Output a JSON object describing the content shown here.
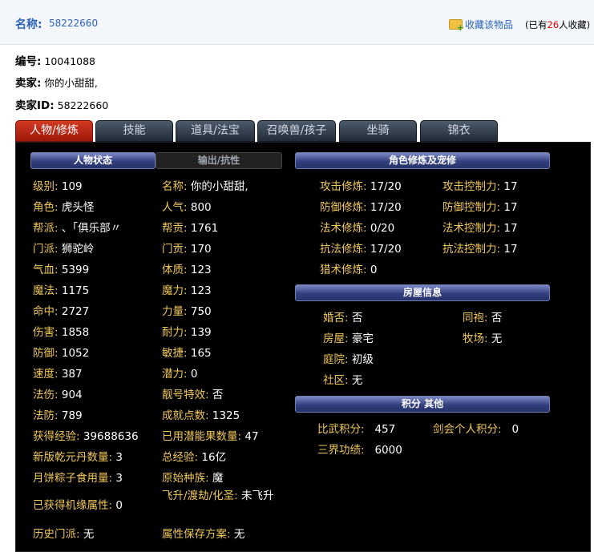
{
  "header": {
    "name_label": "名称:",
    "name_value": "58222660",
    "favorite_link": "收藏该物品",
    "fav_prefix": "(已有",
    "fav_count": "26",
    "fav_suffix": "人收藏)",
    "favorite_icon": "folder-add-icon"
  },
  "meta": {
    "id_label": "编号:",
    "id_value": "10041088",
    "seller_label": "卖家:",
    "seller_value": "你的小甜甜,",
    "seller_id_label": "卖家ID:",
    "seller_id_value": "58222660"
  },
  "tabs": [
    "人物/修炼",
    "技能",
    "道具/法宝",
    "召唤兽/孩子",
    "坐骑",
    "锦衣"
  ],
  "sections": {
    "char_status": "人物状态",
    "output": "输出/抗性",
    "cultivation": "角色修炼及宠修",
    "house": "房屋信息",
    "score": "积分 其他"
  },
  "left_col": [
    {
      "label": "级别:",
      "value": "109"
    },
    {
      "label": "角色:",
      "value": "虎头怪"
    },
    {
      "label": "帮派:",
      "value": "、「俱乐部〃"
    },
    {
      "label": "门派:",
      "value": "狮驼岭"
    },
    {
      "label": "气血:",
      "value": "5399"
    },
    {
      "label": "魔法:",
      "value": "1175"
    },
    {
      "label": "命中:",
      "value": "2727"
    },
    {
      "label": "伤害:",
      "value": "1858"
    },
    {
      "label": "防御:",
      "value": "1052"
    },
    {
      "label": "速度:",
      "value": "387"
    },
    {
      "label": "法伤:",
      "value": "904"
    },
    {
      "label": "法防:",
      "value": "789"
    },
    {
      "label": "获得经验:",
      "value": "39688636"
    },
    {
      "label": "新版乾元丹数量:",
      "value": "3"
    },
    {
      "label": "月饼粽子食用量:",
      "value": "3"
    },
    {
      "label": "已获得机缘属性:",
      "value": "0"
    },
    {
      "label": "历史门派:",
      "value": "无"
    }
  ],
  "mid_col": [
    {
      "label": "名称:",
      "value": "你的小甜甜,"
    },
    {
      "label": "人气:",
      "value": "800"
    },
    {
      "label": "帮贡:",
      "value": "1761"
    },
    {
      "label": "门贡:",
      "value": "170"
    },
    {
      "label": "体质:",
      "value": "123"
    },
    {
      "label": "魔力:",
      "value": "123"
    },
    {
      "label": "力量:",
      "value": "750"
    },
    {
      "label": "耐力:",
      "value": "139"
    },
    {
      "label": "敏捷:",
      "value": "165"
    },
    {
      "label": "潜力:",
      "value": "0"
    },
    {
      "label": "靓号特效:",
      "value": "否"
    },
    {
      "label": "成就点数:",
      "value": "1325"
    },
    {
      "label": "已用潜能果数量:",
      "value": "47"
    },
    {
      "label": "总经验:",
      "value": "16亿"
    },
    {
      "label": "原始种族:",
      "value": "魔"
    },
    {
      "label": "飞升/渡劫/化圣:",
      "value": "未飞升"
    },
    {
      "label": "属性保存方案:",
      "value": "无"
    }
  ],
  "cultivation": [
    {
      "label": "攻击修炼:",
      "value": "17/20",
      "label2": "攻击控制力:",
      "value2": "17"
    },
    {
      "label": "防御修炼:",
      "value": "17/20",
      "label2": "防御控制力:",
      "value2": "17"
    },
    {
      "label": "法术修炼:",
      "value": "0/20",
      "label2": "法术控制力:",
      "value2": "17"
    },
    {
      "label": "抗法修炼:",
      "value": "17/20",
      "label2": "抗法控制力:",
      "value2": "17"
    },
    {
      "label": "猎术修炼:",
      "value": "0"
    }
  ],
  "house": {
    "married_label": "婚否:",
    "married_value": "否",
    "robe_label": "同袍:",
    "robe_value": "否",
    "house_label": "房屋:",
    "house_value": "豪宅",
    "ranch_label": "牧场:",
    "ranch_value": "无",
    "yard_label": "庭院:",
    "yard_value": "初级",
    "community_label": "社区:",
    "community_value": "无"
  },
  "score": {
    "pvp_label": "比武积分:",
    "pvp_value": "457",
    "guild_label": "剑会个人积分:",
    "guild_value": "0",
    "merit_label": "三界功绩:",
    "merit_value": "6000"
  },
  "colors": {
    "label": "#f0c75a",
    "value": "#ffffff",
    "link": "#2a63b6",
    "active_tab": "#c02a14"
  }
}
